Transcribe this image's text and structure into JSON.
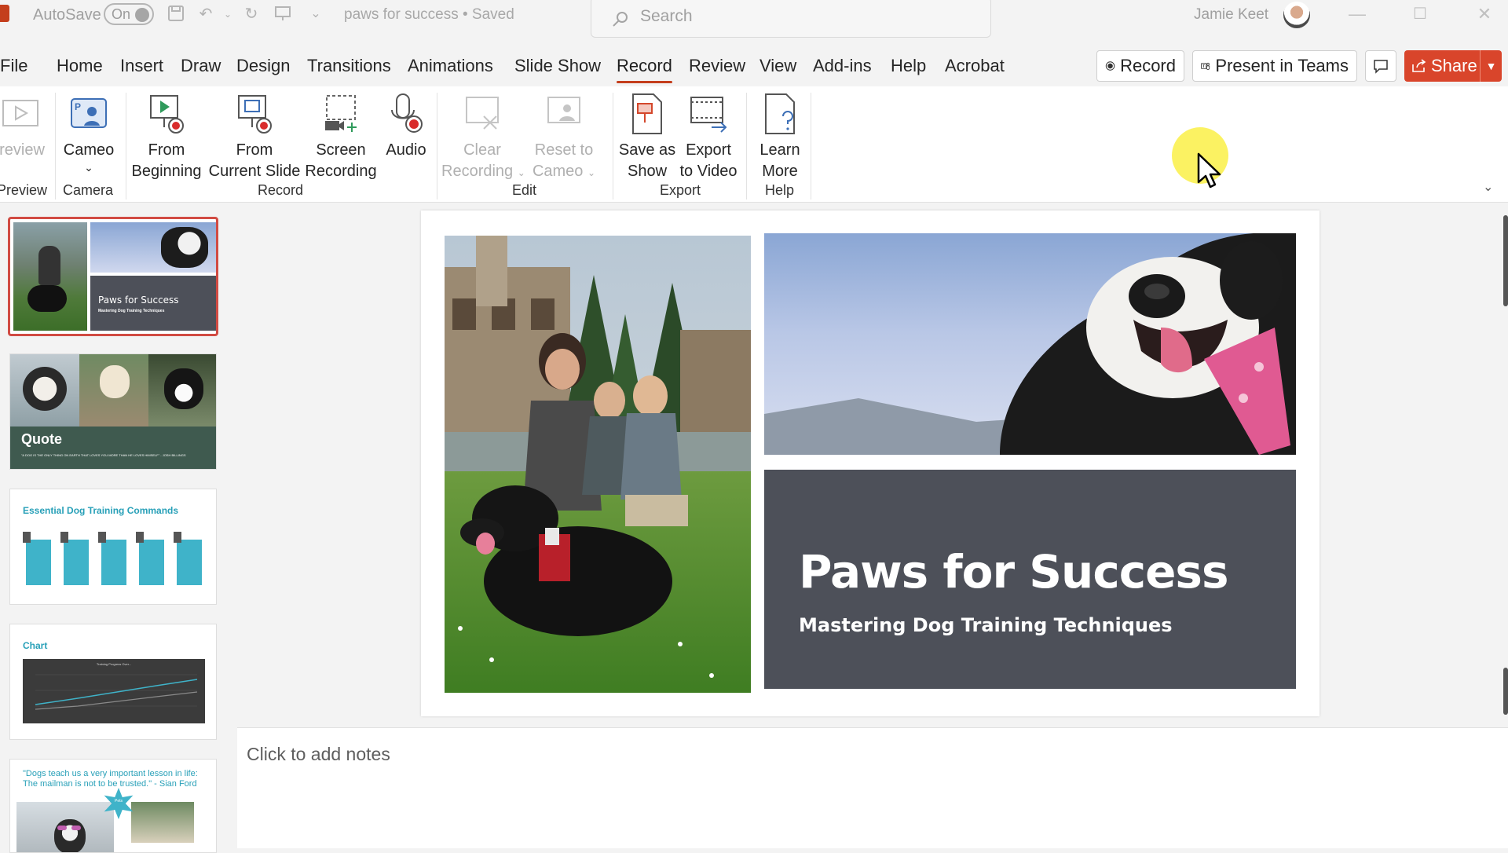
{
  "titlebar": {
    "autosave_label": "AutoSave",
    "autosave_state": "On",
    "doc_title": "paws for success • Saved",
    "search_placeholder": "Search",
    "user_name": "Jamie Keet"
  },
  "tabs": [
    "File",
    "Home",
    "Insert",
    "Draw",
    "Design",
    "Transitions",
    "Animations",
    "Slide Show",
    "Record",
    "Review",
    "View",
    "Add-ins",
    "Help",
    "Acrobat"
  ],
  "active_tab": "Record",
  "top_buttons": {
    "record": "Record",
    "present_in_teams": "Present in Teams",
    "share": "Share"
  },
  "ribbon": {
    "preview": {
      "label": "review",
      "group": "Preview"
    },
    "cameo": {
      "label": "Cameo",
      "group": "Camera"
    },
    "from_beginning": {
      "line1": "From",
      "line2": "Beginning"
    },
    "from_current": {
      "line1": "From",
      "line2": "Current Slide"
    },
    "screen_recording": {
      "line1": "Screen",
      "line2": "Recording"
    },
    "audio": {
      "label": "Audio"
    },
    "record_group": "Record",
    "clear_recording": {
      "line1": "Clear",
      "line2": "Recording"
    },
    "reset_cameo": {
      "line1": "Reset to",
      "line2": "Cameo"
    },
    "edit_group": "Edit",
    "save_as_show": {
      "line1": "Save as",
      "line2": "Show"
    },
    "export_video": {
      "line1": "Export",
      "line2": "to Video"
    },
    "export_group": "Export",
    "learn_more": {
      "line1": "Learn",
      "line2": "More"
    },
    "help_group": "Help"
  },
  "thumbnails": {
    "slide1": {
      "title": "Paws for Success",
      "subtitle": "Mastering Dog Training Techniques"
    },
    "slide2": {
      "title": "Quote",
      "text": "\"A DOG IS THE ONLY THING ON EARTH THAT LOVES YOU MORE THAN HE LOVES HIMSELF\" - JOSH BILLINGS"
    },
    "slide3": {
      "title": "Essential Dog Training Commands"
    },
    "slide4": {
      "title": "Chart",
      "chart_title": "Training Progress Over..."
    },
    "slide5": {
      "quote": "\"Dogs teach us a very important lesson in life: The mailman is not to be trusted.\" - Sian Ford",
      "badge": "Pets"
    }
  },
  "slide": {
    "title": "Paws for Success",
    "subtitle": "Mastering Dog Training Techniques"
  },
  "notes_placeholder": "Click to add notes",
  "colors": {
    "accent": "#c43e1c",
    "share": "#d9452b",
    "title_box": "#4d5059",
    "teal": "#28a0b8"
  }
}
